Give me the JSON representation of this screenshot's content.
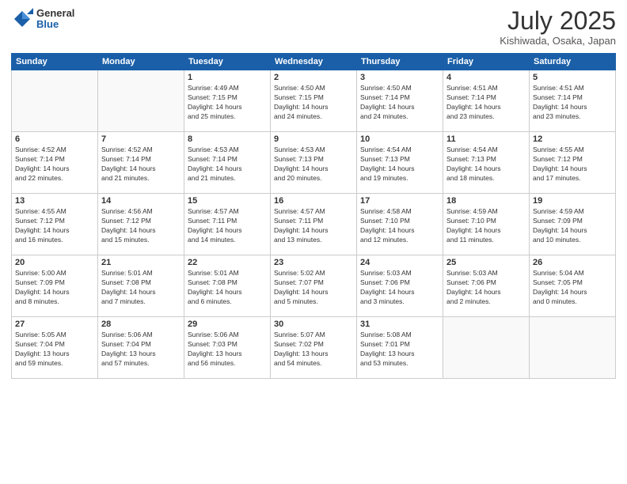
{
  "header": {
    "logo": {
      "general": "General",
      "blue": "Blue"
    },
    "title": "July 2025",
    "location": "Kishiwada, Osaka, Japan"
  },
  "weekdays": [
    "Sunday",
    "Monday",
    "Tuesday",
    "Wednesday",
    "Thursday",
    "Friday",
    "Saturday"
  ],
  "weeks": [
    [
      {
        "day": "",
        "info": ""
      },
      {
        "day": "",
        "info": ""
      },
      {
        "day": "1",
        "info": "Sunrise: 4:49 AM\nSunset: 7:15 PM\nDaylight: 14 hours\nand 25 minutes."
      },
      {
        "day": "2",
        "info": "Sunrise: 4:50 AM\nSunset: 7:15 PM\nDaylight: 14 hours\nand 24 minutes."
      },
      {
        "day": "3",
        "info": "Sunrise: 4:50 AM\nSunset: 7:14 PM\nDaylight: 14 hours\nand 24 minutes."
      },
      {
        "day": "4",
        "info": "Sunrise: 4:51 AM\nSunset: 7:14 PM\nDaylight: 14 hours\nand 23 minutes."
      },
      {
        "day": "5",
        "info": "Sunrise: 4:51 AM\nSunset: 7:14 PM\nDaylight: 14 hours\nand 23 minutes."
      }
    ],
    [
      {
        "day": "6",
        "info": "Sunrise: 4:52 AM\nSunset: 7:14 PM\nDaylight: 14 hours\nand 22 minutes."
      },
      {
        "day": "7",
        "info": "Sunrise: 4:52 AM\nSunset: 7:14 PM\nDaylight: 14 hours\nand 21 minutes."
      },
      {
        "day": "8",
        "info": "Sunrise: 4:53 AM\nSunset: 7:14 PM\nDaylight: 14 hours\nand 21 minutes."
      },
      {
        "day": "9",
        "info": "Sunrise: 4:53 AM\nSunset: 7:13 PM\nDaylight: 14 hours\nand 20 minutes."
      },
      {
        "day": "10",
        "info": "Sunrise: 4:54 AM\nSunset: 7:13 PM\nDaylight: 14 hours\nand 19 minutes."
      },
      {
        "day": "11",
        "info": "Sunrise: 4:54 AM\nSunset: 7:13 PM\nDaylight: 14 hours\nand 18 minutes."
      },
      {
        "day": "12",
        "info": "Sunrise: 4:55 AM\nSunset: 7:12 PM\nDaylight: 14 hours\nand 17 minutes."
      }
    ],
    [
      {
        "day": "13",
        "info": "Sunrise: 4:55 AM\nSunset: 7:12 PM\nDaylight: 14 hours\nand 16 minutes."
      },
      {
        "day": "14",
        "info": "Sunrise: 4:56 AM\nSunset: 7:12 PM\nDaylight: 14 hours\nand 15 minutes."
      },
      {
        "day": "15",
        "info": "Sunrise: 4:57 AM\nSunset: 7:11 PM\nDaylight: 14 hours\nand 14 minutes."
      },
      {
        "day": "16",
        "info": "Sunrise: 4:57 AM\nSunset: 7:11 PM\nDaylight: 14 hours\nand 13 minutes."
      },
      {
        "day": "17",
        "info": "Sunrise: 4:58 AM\nSunset: 7:10 PM\nDaylight: 14 hours\nand 12 minutes."
      },
      {
        "day": "18",
        "info": "Sunrise: 4:59 AM\nSunset: 7:10 PM\nDaylight: 14 hours\nand 11 minutes."
      },
      {
        "day": "19",
        "info": "Sunrise: 4:59 AM\nSunset: 7:09 PM\nDaylight: 14 hours\nand 10 minutes."
      }
    ],
    [
      {
        "day": "20",
        "info": "Sunrise: 5:00 AM\nSunset: 7:09 PM\nDaylight: 14 hours\nand 8 minutes."
      },
      {
        "day": "21",
        "info": "Sunrise: 5:01 AM\nSunset: 7:08 PM\nDaylight: 14 hours\nand 7 minutes."
      },
      {
        "day": "22",
        "info": "Sunrise: 5:01 AM\nSunset: 7:08 PM\nDaylight: 14 hours\nand 6 minutes."
      },
      {
        "day": "23",
        "info": "Sunrise: 5:02 AM\nSunset: 7:07 PM\nDaylight: 14 hours\nand 5 minutes."
      },
      {
        "day": "24",
        "info": "Sunrise: 5:03 AM\nSunset: 7:06 PM\nDaylight: 14 hours\nand 3 minutes."
      },
      {
        "day": "25",
        "info": "Sunrise: 5:03 AM\nSunset: 7:06 PM\nDaylight: 14 hours\nand 2 minutes."
      },
      {
        "day": "26",
        "info": "Sunrise: 5:04 AM\nSunset: 7:05 PM\nDaylight: 14 hours\nand 0 minutes."
      }
    ],
    [
      {
        "day": "27",
        "info": "Sunrise: 5:05 AM\nSunset: 7:04 PM\nDaylight: 13 hours\nand 59 minutes."
      },
      {
        "day": "28",
        "info": "Sunrise: 5:06 AM\nSunset: 7:04 PM\nDaylight: 13 hours\nand 57 minutes."
      },
      {
        "day": "29",
        "info": "Sunrise: 5:06 AM\nSunset: 7:03 PM\nDaylight: 13 hours\nand 56 minutes."
      },
      {
        "day": "30",
        "info": "Sunrise: 5:07 AM\nSunset: 7:02 PM\nDaylight: 13 hours\nand 54 minutes."
      },
      {
        "day": "31",
        "info": "Sunrise: 5:08 AM\nSunset: 7:01 PM\nDaylight: 13 hours\nand 53 minutes."
      },
      {
        "day": "",
        "info": ""
      },
      {
        "day": "",
        "info": ""
      }
    ]
  ]
}
